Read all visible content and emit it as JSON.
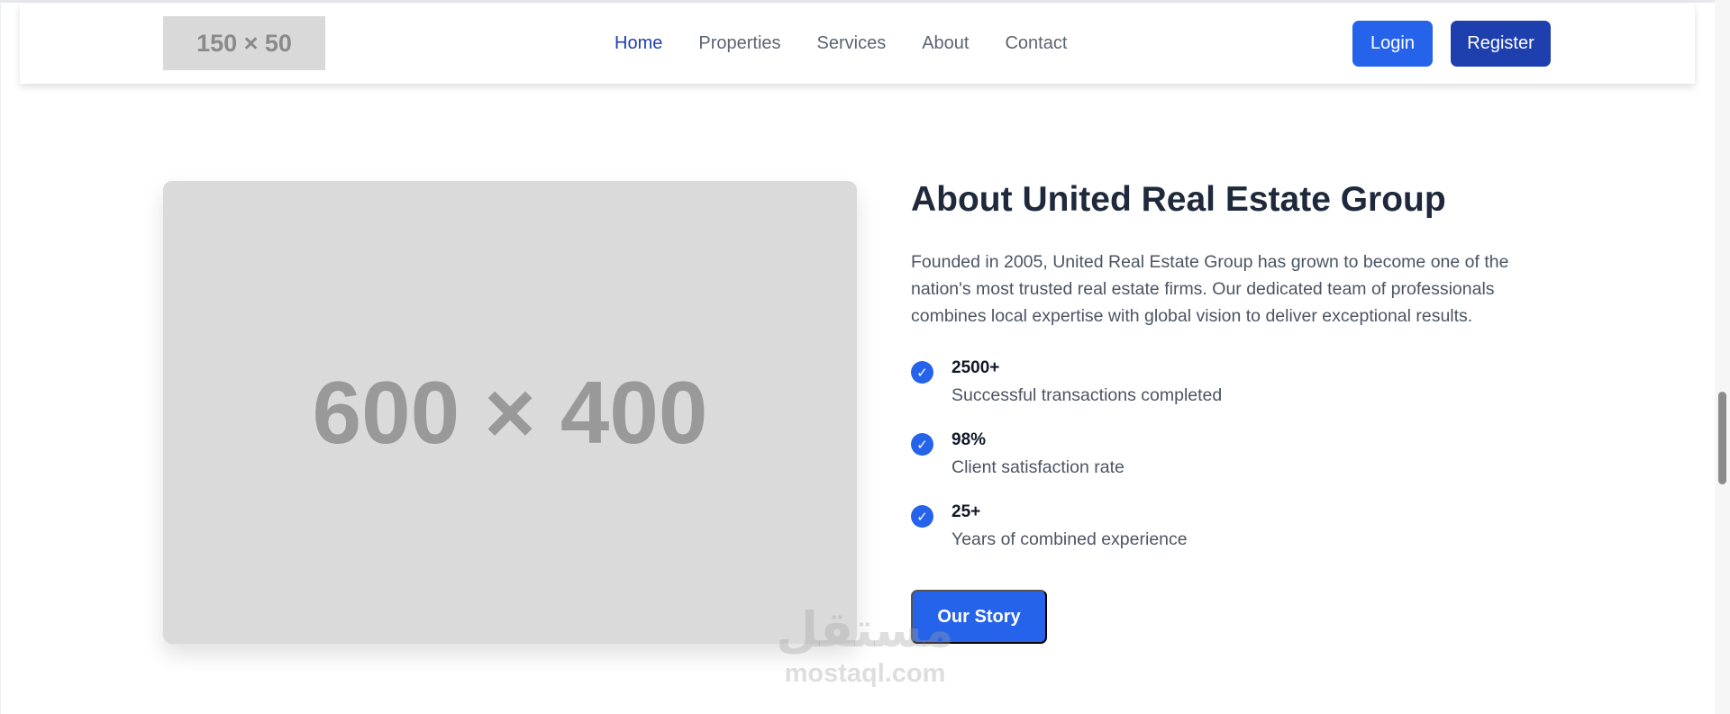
{
  "header": {
    "logo_text": "150 × 50",
    "nav": [
      {
        "label": "Home",
        "active": true
      },
      {
        "label": "Properties",
        "active": false
      },
      {
        "label": "Services",
        "active": false
      },
      {
        "label": "About",
        "active": false
      },
      {
        "label": "Contact",
        "active": false
      }
    ],
    "login_label": "Login",
    "register_label": "Register"
  },
  "main": {
    "image_placeholder": "600 × 400",
    "title": "About United Real Estate Group",
    "description": "Founded in 2005, United Real Estate Group has grown to become one of the nation's most trusted real estate firms. Our dedicated team of professionals combines local expertise with global vision to deliver exceptional results.",
    "stats": [
      {
        "value": "2500+",
        "label": "Successful transactions completed"
      },
      {
        "value": "98%",
        "label": "Client satisfaction rate"
      },
      {
        "value": "25+",
        "label": "Years of combined experience"
      }
    ],
    "cta_label": "Our Story"
  },
  "watermark": {
    "logo": "مستقل",
    "text": "mostaql.com"
  },
  "colors": {
    "primary": "#2563eb",
    "primary_dark": "#1e40af",
    "placeholder": "#dadada"
  }
}
